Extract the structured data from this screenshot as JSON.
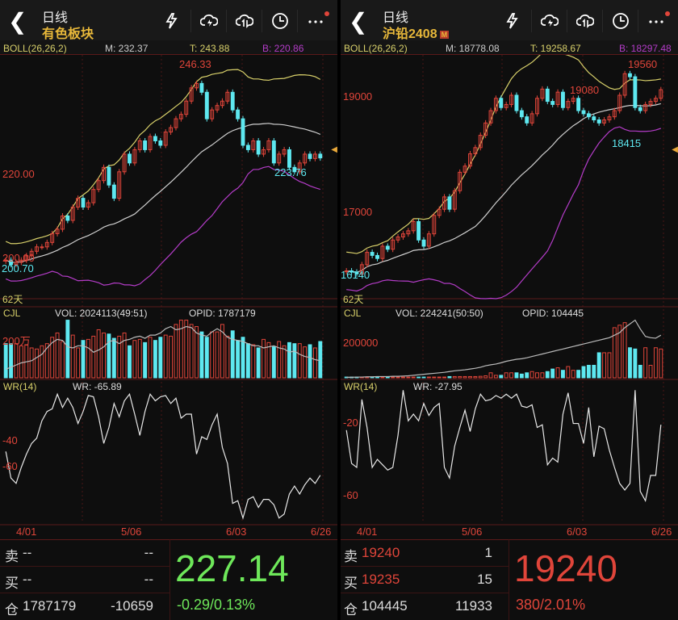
{
  "left": {
    "title": "日线",
    "name": "有色板块",
    "boll": {
      "label": "BOLL(26,26,2)",
      "m": "M: 232.37",
      "t": "T: 243.88",
      "b": "B: 220.86"
    },
    "axis": {
      "hi": "246.33",
      "lo_mark": "223.76",
      "p220": "220.00",
      "p200": "200.00",
      "low": "200.70",
      "days": "62天"
    },
    "vol": {
      "label": "CJL",
      "vol": "VOL: 2024113(49:51)",
      "opid": "OPID: 1787179",
      "tick": "200万"
    },
    "wr": {
      "label": "WR(14)",
      "value": "WR: -65.89",
      "t40": "-40",
      "t60": "-60"
    },
    "dates": [
      "4/01",
      "5/06",
      "6/03",
      "6/26"
    ],
    "quote": {
      "sell_label": "卖",
      "sell_price": "--",
      "sell_qty": "--",
      "buy_label": "买",
      "buy_price": "--",
      "buy_qty": "--",
      "oi_label": "仓",
      "oi": "1787179",
      "oi_chg": "-10659",
      "last": "227.14",
      "change": "-0.29/0.13%"
    }
  },
  "right": {
    "title": "日线",
    "name": "沪铅2408",
    "badge": "M",
    "boll": {
      "label": "BOLL(26,26,2)",
      "m": "M: 18778.08",
      "t": "T: 19258.67",
      "b": "B: 18297.48"
    },
    "axis": {
      "hi": "19560",
      "mid_hi": "19080",
      "lo_mark": "18415",
      "p19000": "19000",
      "p17000": "17000",
      "low": "16140",
      "days": "62天"
    },
    "vol": {
      "label": "CJL",
      "vol": "VOL: 224241(50:50)",
      "opid": "OPID: 104445",
      "tick": "200000"
    },
    "wr": {
      "label": "WR(14)",
      "value": "WR: -27.95",
      "t20": "-20",
      "t60": "-60"
    },
    "dates": [
      "4/01",
      "5/06",
      "6/03",
      "6/26"
    ],
    "quote": {
      "sell_label": "卖",
      "sell_price": "19240",
      "sell_qty": "1",
      "buy_label": "买",
      "buy_price": "19235",
      "buy_qty": "15",
      "oi_label": "仓",
      "oi": "104445",
      "oi_chg": "11933",
      "last": "19240",
      "change": "380/2.01%"
    }
  },
  "colors": {
    "up": "#e0453a",
    "down": "#5ee8f0",
    "green": "#6ee85a",
    "yellow": "#d8d06a",
    "purple": "#b43cc8",
    "mid": "#cfcfcf"
  },
  "icons": [
    "back-icon",
    "flash-icon",
    "cloud-download-icon",
    "cloud-sync-icon",
    "clock-icon",
    "more-icon"
  ],
  "chart_data": [
    {
      "type": "candlestick",
      "name": "有色板块",
      "ylim": [
        196,
        249
      ],
      "close": [
        204,
        203,
        203.5,
        204,
        205,
        206,
        207,
        207,
        208,
        210,
        211,
        214,
        213,
        216,
        218,
        216,
        217,
        220,
        222,
        225,
        221,
        218,
        224,
        228,
        226,
        229,
        231,
        229,
        232,
        231,
        230,
        233,
        234,
        236,
        237,
        240,
        243,
        244,
        242,
        236,
        238,
        239,
        240,
        242,
        238,
        236,
        230,
        229,
        231,
        228,
        229,
        231,
        226,
        228,
        229,
        225,
        224,
        226,
        228,
        227,
        228,
        227.14
      ],
      "volume": [
        160,
        160,
        160,
        150,
        155,
        140,
        135,
        150,
        160,
        190,
        210,
        170,
        270,
        200,
        140,
        175,
        180,
        195,
        225,
        210,
        205,
        185,
        195,
        210,
        150,
        175,
        180,
        165,
        190,
        175,
        190,
        200,
        195,
        250,
        270,
        270,
        250,
        240,
        215,
        190,
        215,
        215,
        250,
        195,
        220,
        175,
        190,
        160,
        155,
        140,
        180,
        165,
        145,
        170,
        150,
        165,
        160,
        160,
        145,
        155,
        140,
        170
      ],
      "opid": [
        40,
        50,
        60,
        70,
        75,
        80,
        95,
        110,
        140,
        165,
        180,
        175,
        145,
        140,
        150,
        150,
        140,
        120,
        130,
        145,
        170,
        175,
        160,
        175,
        180,
        190,
        195,
        185,
        200,
        200,
        210,
        230,
        240,
        225,
        230,
        240,
        235,
        210,
        200,
        195,
        215,
        230,
        215,
        190,
        180,
        175,
        170,
        160,
        150,
        150,
        140,
        145,
        150,
        140,
        135,
        120,
        125,
        110,
        100,
        95,
        85,
        80
      ],
      "wr": [
        -48,
        -68,
        -72,
        -60,
        -50,
        -42,
        -38,
        -25,
        -18,
        -16,
        -5,
        -15,
        -8,
        -15,
        -27,
        -18,
        -6,
        -7,
        -22,
        -42,
        -30,
        -12,
        -22,
        -10,
        -5,
        -20,
        -36,
        -18,
        -5,
        -10,
        -7,
        -6,
        -12,
        -8,
        -23,
        -20,
        -20,
        -50,
        -37,
        -39,
        -28,
        -20,
        -45,
        -57,
        -87,
        -85,
        -98,
        -84,
        -82,
        -90,
        -84,
        -84,
        -88,
        -98,
        -95,
        -80,
        -74,
        -80,
        -73,
        -68,
        -72,
        -65.89
      ]
    },
    {
      "type": "candlestick",
      "name": "沪铅2408",
      "ylim": [
        15900,
        19700
      ],
      "close": [
        16300,
        16280,
        16250,
        16400,
        16600,
        16550,
        16500,
        16700,
        16650,
        16800,
        16850,
        16900,
        16950,
        17100,
        16800,
        16700,
        16900,
        17200,
        17300,
        17500,
        17300,
        17600,
        17900,
        18000,
        18200,
        18300,
        18500,
        18700,
        18900,
        19100,
        18950,
        19000,
        19150,
        18900,
        18800,
        18700,
        18850,
        19100,
        19250,
        19050,
        19000,
        19200,
        18950,
        19050,
        19100,
        18900,
        18850,
        18800,
        18750,
        18700,
        18750,
        18800,
        18900,
        19150,
        19500,
        19450,
        18950,
        18900,
        19000,
        19050,
        19100,
        19240
      ],
      "volume": [
        3,
        3,
        3,
        3,
        3,
        3,
        3,
        3,
        3,
        3,
        3,
        3,
        3,
        3,
        3,
        3,
        3,
        3,
        3,
        3,
        5,
        5,
        5,
        5,
        5,
        5,
        6,
        8,
        20,
        10,
        10,
        20,
        20,
        20,
        15,
        20,
        25,
        20,
        20,
        25,
        35,
        40,
        30,
        45,
        30,
        30,
        45,
        50,
        50,
        100,
        100,
        100,
        200,
        210,
        220,
        120,
        115,
        50,
        120,
        50,
        120,
        115
      ],
      "opid": [
        2,
        2,
        3,
        3,
        4,
        4,
        5,
        5,
        5,
        6,
        6,
        7,
        8,
        10,
        12,
        14,
        16,
        18,
        20,
        22,
        25,
        28,
        30,
        32,
        35,
        38,
        42,
        48,
        52,
        55,
        60,
        66,
        70,
        74,
        76,
        80,
        85,
        90,
        95,
        100,
        105,
        110,
        115,
        120,
        125,
        130,
        135,
        140,
        145,
        150,
        155,
        160,
        170,
        180,
        200,
        215,
        230,
        195,
        165,
        160,
        158,
        170
      ],
      "wr": [
        -32,
        -57,
        -60,
        -9,
        -30,
        -60,
        -54,
        -58,
        -62,
        -60,
        -36,
        -2,
        -25,
        -20,
        -25,
        -12,
        -21,
        -15,
        -12,
        -60,
        -68,
        -44,
        -30,
        -17,
        -33,
        -16,
        -5,
        -10,
        -9,
        -6,
        -8,
        -5,
        -8,
        -5,
        -14,
        -15,
        -13,
        -30,
        -28,
        -58,
        -53,
        -56,
        -20,
        -4,
        -27,
        -27,
        -42,
        -15,
        -52,
        -29,
        -31,
        -47,
        -60,
        -72,
        -77,
        -72,
        -2,
        -78,
        -85,
        -66,
        -66,
        -27.95
      ]
    }
  ]
}
